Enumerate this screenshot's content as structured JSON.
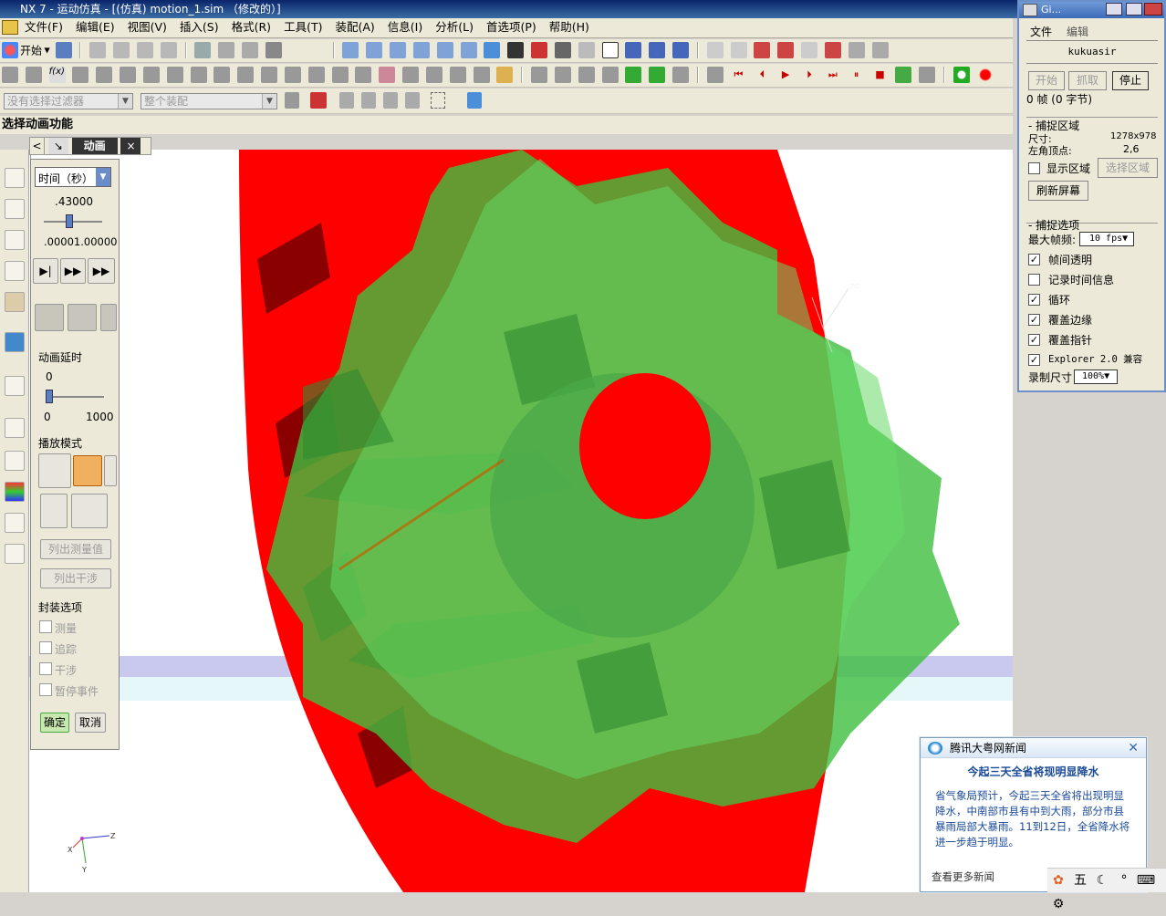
{
  "window": {
    "title": "NX 7 - 运动仿真 - [(仿真) motion_1.sim （修改的）]"
  },
  "menu": [
    "文件(F)",
    "编辑(E)",
    "视图(V)",
    "插入(S)",
    "格式(R)",
    "工具(T)",
    "装配(A)",
    "信息(I)",
    "分析(L)",
    "首选项(P)",
    "帮助(H)"
  ],
  "toolbar": {
    "start_label": "开始"
  },
  "filters": {
    "selection_filter": "没有选择过滤器",
    "assembly_scope": "整个装配"
  },
  "status_prompt": "选择动画功能",
  "nav": {
    "back": "<",
    "title": "动画",
    "close": "×",
    "forward": ">"
  },
  "animation_panel": {
    "time_dropdown": "时间（秒）",
    "time_value": ".43000",
    "time_range": ".00001.00000",
    "time_fraction": 0.43,
    "delay_label": "动画延时",
    "delay_value": "0",
    "delay_min": "0",
    "delay_max": "1000",
    "playback_mode_label": "播放模式",
    "list_measurements": "列出测量值",
    "list_interference": "列出干涉",
    "package_options_label": "封装选项",
    "options": [
      "测量",
      "追踪",
      "干涉",
      "暂停事件"
    ],
    "ok": "确定",
    "cancel": "取消"
  },
  "gif_recorder": {
    "title": "Gi...",
    "menu_file": "文件",
    "menu_edit": "编辑",
    "user": "kukuasir",
    "btn_start": "开始",
    "btn_grab": "抓取",
    "btn_stop": "停止",
    "frame_count": "0 帧 (0 字节)",
    "capture_area_title": "捕捉区域",
    "size_label": "尺寸:",
    "size_value": "1278x978",
    "corner_label": "左角顶点:",
    "corner_value": "2,6",
    "show_area": "显示区域",
    "select_area": "选择区域",
    "refresh_screen": "刷新屏幕",
    "capture_options_title": "捕捉选项",
    "max_fps_label": "最大帧频:",
    "max_fps_value": "10 fps",
    "checks": [
      {
        "label": "帧间透明",
        "checked": true
      },
      {
        "label": "记录时间信息",
        "checked": false
      },
      {
        "label": "循环",
        "checked": true
      },
      {
        "label": "覆盖边缘",
        "checked": true
      },
      {
        "label": "覆盖指针",
        "checked": true
      },
      {
        "label": "Explorer 2.0 兼容",
        "checked": true
      }
    ],
    "record_size_label": "录制尺寸",
    "record_size_value": "100%"
  },
  "news_popup": {
    "source": "腾讯大粤网新闻",
    "headline": "今起三天全省将现明显降水",
    "body": "省气象局预计，今起三天全省将出现明显降水，中南部市县有中到大雨，部分市县暴雨局部大暴雨。11到12日，全省降水将进一步趋于明显。",
    "more": "查看更多新闻"
  },
  "tray_ime": "五",
  "axes": {
    "x": "X",
    "y": "Y",
    "z": "Z",
    "xc": "XC",
    "yc": "YC",
    "zc": "ZC"
  },
  "colors": {
    "gear_red": "#ff0000",
    "gear_green": "#3ed13e",
    "viewport_bg": "#ffffff"
  }
}
